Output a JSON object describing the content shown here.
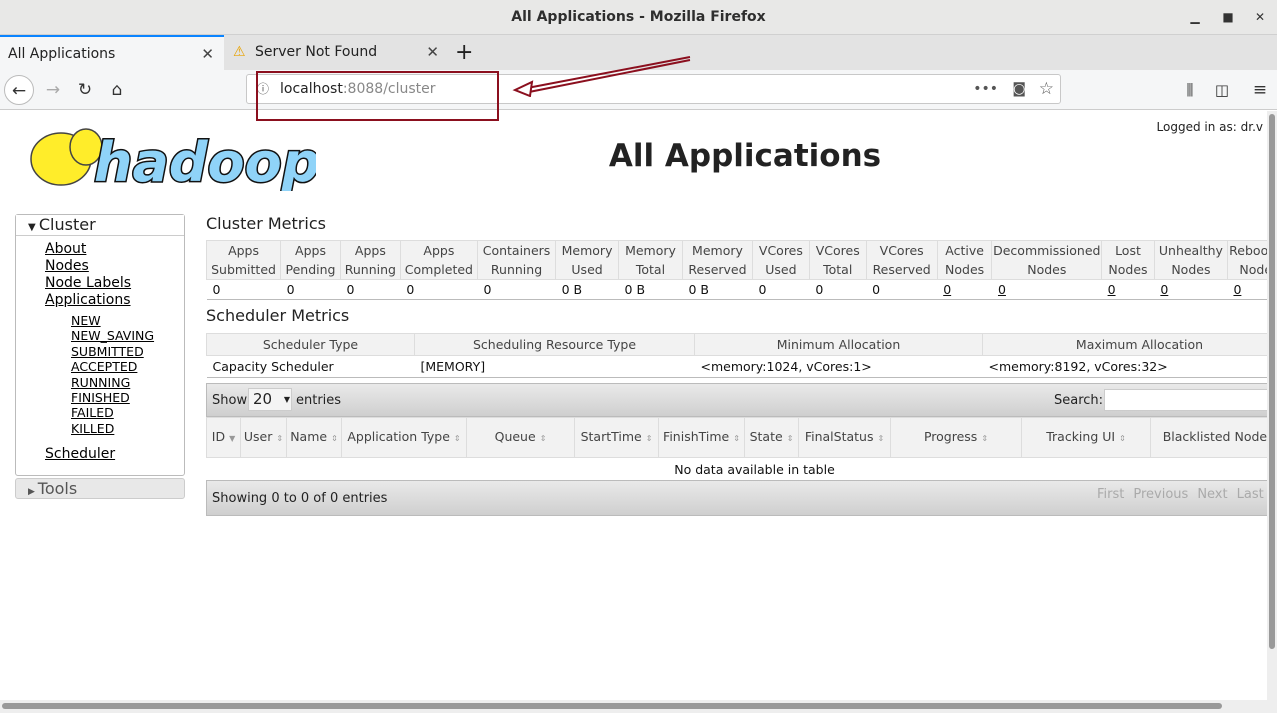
{
  "window": {
    "title": "All Applications - Mozilla Firefox"
  },
  "tabs": [
    {
      "label": "All Applications",
      "active": true
    },
    {
      "label": "Server Not Found",
      "icon": "warning-icon"
    }
  ],
  "url": {
    "host": "localhost",
    "path": ":8088/cluster"
  },
  "header": {
    "logged_in": "Logged in as: dr.v",
    "title": "All Applications",
    "logo": "hadoop"
  },
  "sidebar": {
    "cluster": "Cluster",
    "links": [
      "About",
      "Nodes",
      "Node Labels",
      "Applications"
    ],
    "states": [
      "NEW",
      "NEW_SAVING",
      "SUBMITTED",
      "ACCEPTED",
      "RUNNING",
      "FINISHED",
      "FAILED",
      "KILLED"
    ],
    "scheduler": "Scheduler",
    "tools": "Tools"
  },
  "cluster_metrics": {
    "title": "Cluster Metrics",
    "headers": [
      [
        "Apps",
        "Submitted"
      ],
      [
        "Apps",
        "Pending"
      ],
      [
        "Apps",
        "Running"
      ],
      [
        "Apps",
        "Completed"
      ],
      [
        "Containers",
        "Running"
      ],
      [
        "Memory",
        "Used"
      ],
      [
        "Memory",
        "Total"
      ],
      [
        "Memory",
        "Reserved"
      ],
      [
        "VCores",
        "Used"
      ],
      [
        "VCores",
        "Total"
      ],
      [
        "VCores",
        "Reserved"
      ],
      [
        "Active",
        "Nodes"
      ],
      [
        "Decommissioned",
        "Nodes"
      ],
      [
        "Lost",
        "Nodes"
      ],
      [
        "Unhealthy",
        "Nodes"
      ],
      [
        "Rebooted",
        "Nodes"
      ]
    ],
    "values": [
      "0",
      "0",
      "0",
      "0",
      "0",
      "0 B",
      "0 B",
      "0 B",
      "0",
      "0",
      "0",
      "0",
      "0",
      "0",
      "0",
      "0"
    ]
  },
  "scheduler_metrics": {
    "title": "Scheduler Metrics",
    "headers": [
      "Scheduler Type",
      "Scheduling Resource Type",
      "Minimum Allocation",
      "Maximum Allocation"
    ],
    "values": [
      "Capacity Scheduler",
      "[MEMORY]",
      "<memory:1024, vCores:1>",
      "<memory:8192, vCores:32>"
    ]
  },
  "apps": {
    "show": "Show",
    "entries_value": "20",
    "entries": "entries",
    "search": "Search:",
    "search_value": "",
    "headers": [
      "ID",
      "User",
      "Name",
      "Application Type",
      "Queue",
      "StartTime",
      "FinishTime",
      "State",
      "FinalStatus",
      "Progress",
      "Tracking UI",
      "Blacklisted Nodes"
    ],
    "empty": "No data available in table",
    "info": "Showing 0 to 0 of 0 entries",
    "pager": [
      "First",
      "Previous",
      "Next",
      "Last"
    ]
  }
}
